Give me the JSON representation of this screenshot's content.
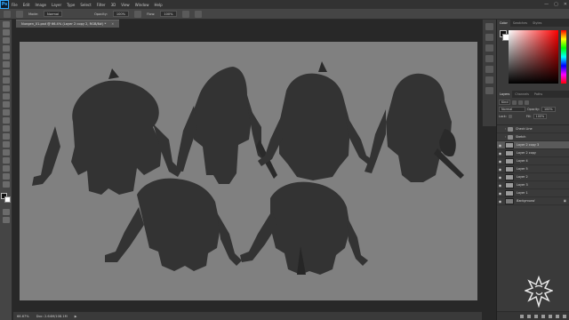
{
  "app": {
    "logo": "Ps"
  },
  "menu": [
    "File",
    "Edit",
    "Image",
    "Layer",
    "Type",
    "Select",
    "Filter",
    "3D",
    "View",
    "Window",
    "Help"
  ],
  "window_controls": [
    "—",
    "▢",
    "✕"
  ],
  "options_bar": {
    "mode_label": "Mode:",
    "mode_value": "Normal",
    "opacity_label": "Opacity:",
    "opacity_value": "100%",
    "flow_label": "Flow:",
    "flow_value": "100%"
  },
  "document": {
    "tab_label": "Nungen_01.psd @ 66.4% (Layer 2 copy 2, RGB/8#) *",
    "tab_close": "✕"
  },
  "status": {
    "zoom": "66.67%",
    "doc_info": "Doc: 2.64M/108.1M"
  },
  "color_panel": {
    "tabs": [
      "Color",
      "Swatches",
      "Styles"
    ],
    "fg": "#111111",
    "bg": "#ffffff"
  },
  "layers_panel": {
    "tabs": [
      "Layers",
      "Channels",
      "Paths"
    ],
    "kind_label": "Kind",
    "blend_mode": "Normal",
    "opacity_label": "Opacity:",
    "opacity_value": "100%",
    "lock_label": "Lock:",
    "fill_label": "Fill:",
    "fill_value": "100%",
    "layers": [
      {
        "name": "Check Line",
        "type": "folder",
        "visible": false
      },
      {
        "name": "Sketch",
        "type": "folder",
        "visible": false
      },
      {
        "name": "Layer 2 copy 3",
        "type": "layer",
        "visible": true
      },
      {
        "name": "Layer 2 copy",
        "type": "layer",
        "visible": true
      },
      {
        "name": "Layer 4",
        "type": "layer",
        "visible": true
      },
      {
        "name": "Layer 5",
        "type": "layer",
        "visible": true
      },
      {
        "name": "Layer 2",
        "type": "layer",
        "visible": true
      },
      {
        "name": "Layer 3",
        "type": "layer",
        "visible": true
      },
      {
        "name": "Layer 1",
        "type": "layer",
        "visible": true
      },
      {
        "name": "Background",
        "type": "background",
        "visible": true
      }
    ],
    "active_index": 2
  },
  "colors": {
    "canvas": "#808080",
    "silhouette": "#353535",
    "silhouette_dark": "#262626"
  }
}
